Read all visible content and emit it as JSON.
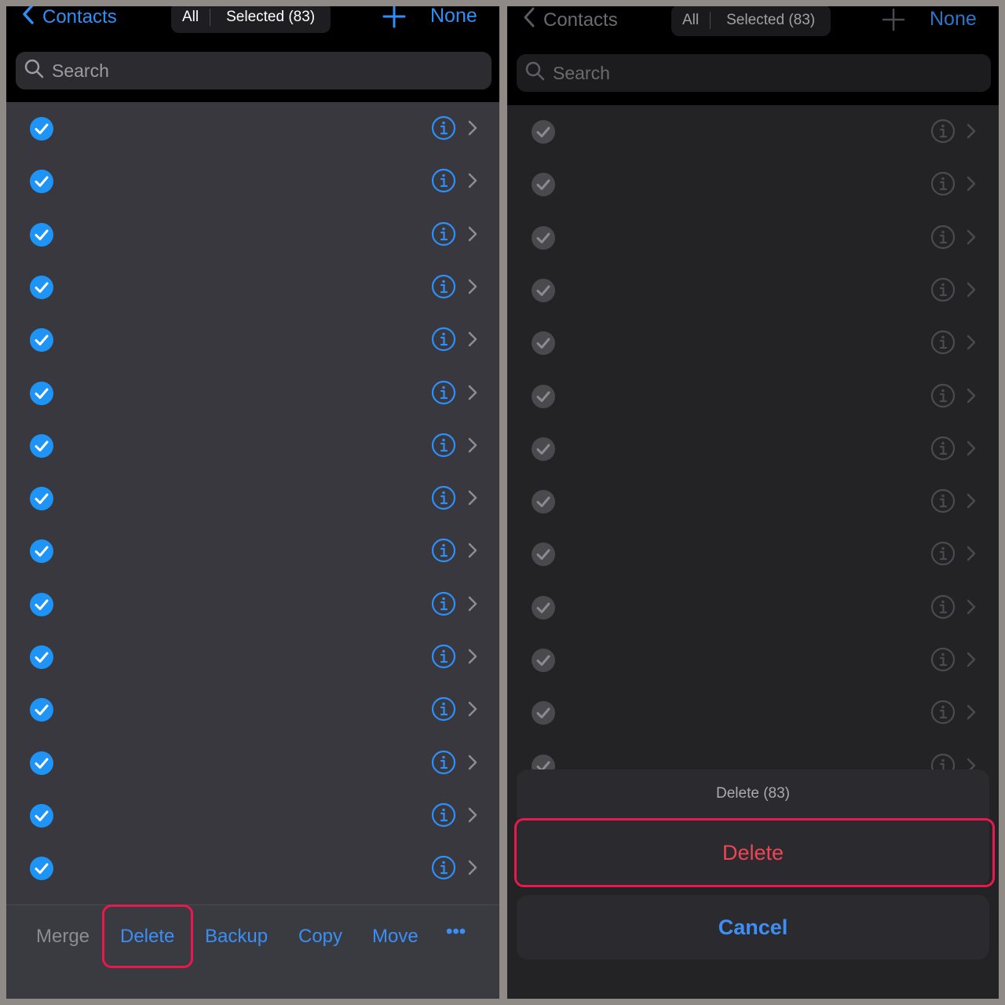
{
  "left": {
    "nav": {
      "back_label": "Contacts",
      "segment_all": "All",
      "segment_selected": "Selected (83)",
      "none_label": "None"
    },
    "search": {
      "placeholder": "Search"
    },
    "toolbar": {
      "merge": "Merge",
      "delete": "Delete",
      "backup": "Backup",
      "copy": "Copy",
      "move": "Move",
      "more": "•••"
    }
  },
  "right": {
    "nav": {
      "back_label": "Contacts",
      "segment_all": "All",
      "segment_selected": "Selected (83)",
      "none_label": "None"
    },
    "search": {
      "placeholder": "Search"
    },
    "sheet": {
      "title": "Delete (83)",
      "delete": "Delete",
      "cancel": "Cancel"
    }
  },
  "colors": {
    "accent": "#2f8ff8",
    "destructive": "#ee4556",
    "highlight": "#e8194e",
    "check_fill": "#1e94f6"
  },
  "icons": [
    "chevron-left-icon",
    "plus-icon",
    "search-icon",
    "checkmark-circle-icon",
    "info-icon",
    "chevron-right-icon"
  ]
}
